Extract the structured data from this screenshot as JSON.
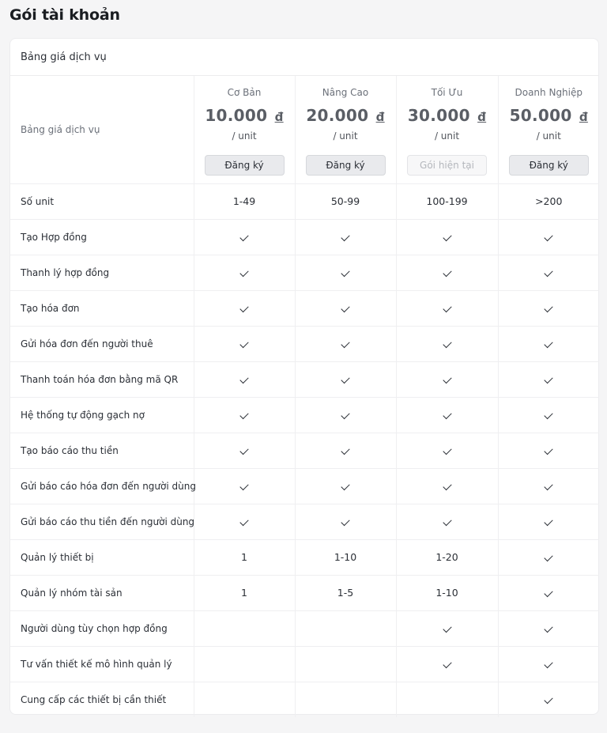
{
  "page": {
    "title": "Gói tài khoản"
  },
  "card": {
    "header": "Bảng giá dịch vụ"
  },
  "table": {
    "header_label": "Bảng giá dịch vụ",
    "plans": [
      {
        "name": "Cơ Bản",
        "price": "10.000",
        "currency": "đ",
        "unit": "/ unit",
        "button": "Đăng ký",
        "current": false
      },
      {
        "name": "Nâng Cao",
        "price": "20.000",
        "currency": "đ",
        "unit": "/ unit",
        "button": "Đăng ký",
        "current": false
      },
      {
        "name": "Tối Ưu",
        "price": "30.000",
        "currency": "đ",
        "unit": "/ unit",
        "button": "Gói hiện tại",
        "current": true
      },
      {
        "name": "Doanh Nghiệp",
        "price": "50.000",
        "currency": "đ",
        "unit": "/ unit",
        "button": "Đăng ký",
        "current": false
      }
    ],
    "features": [
      {
        "label": "Số unit",
        "values": [
          "1-49",
          "50-99",
          "100-199",
          ">200"
        ]
      },
      {
        "label": "Tạo Hợp đồng",
        "values": [
          "check",
          "check",
          "check",
          "check"
        ]
      },
      {
        "label": "Thanh lý hợp đồng",
        "values": [
          "check",
          "check",
          "check",
          "check"
        ]
      },
      {
        "label": "Tạo hóa đơn",
        "values": [
          "check",
          "check",
          "check",
          "check"
        ]
      },
      {
        "label": "Gửi hóa đơn đến người thuê",
        "values": [
          "check",
          "check",
          "check",
          "check"
        ]
      },
      {
        "label": "Thanh toán hóa đơn bằng mã QR",
        "values": [
          "check",
          "check",
          "check",
          "check"
        ]
      },
      {
        "label": "Hệ thống tự động gạch nợ",
        "values": [
          "check",
          "check",
          "check",
          "check"
        ]
      },
      {
        "label": "Tạo báo cáo thu tiền",
        "values": [
          "check",
          "check",
          "check",
          "check"
        ]
      },
      {
        "label": "Gửi báo cáo hóa đơn đến người dùng",
        "values": [
          "check",
          "check",
          "check",
          "check"
        ]
      },
      {
        "label": "Gửi báo cáo thu tiền đến người dùng",
        "values": [
          "check",
          "check",
          "check",
          "check"
        ]
      },
      {
        "label": "Quản lý thiết bị",
        "values": [
          "1",
          "1-10",
          "1-20",
          "check"
        ]
      },
      {
        "label": "Quản lý nhóm tài sản",
        "values": [
          "1",
          "1-5",
          "1-10",
          "check"
        ]
      },
      {
        "label": "Người dùng tùy chọn hợp đồng",
        "values": [
          "",
          "",
          "check",
          "check"
        ]
      },
      {
        "label": "Tư vấn thiết kế mô hình quản lý",
        "values": [
          "",
          "",
          "check",
          "check"
        ]
      },
      {
        "label": "Cung cấp các thiết bị cần thiết",
        "values": [
          "",
          "",
          "",
          "check"
        ]
      }
    ]
  }
}
